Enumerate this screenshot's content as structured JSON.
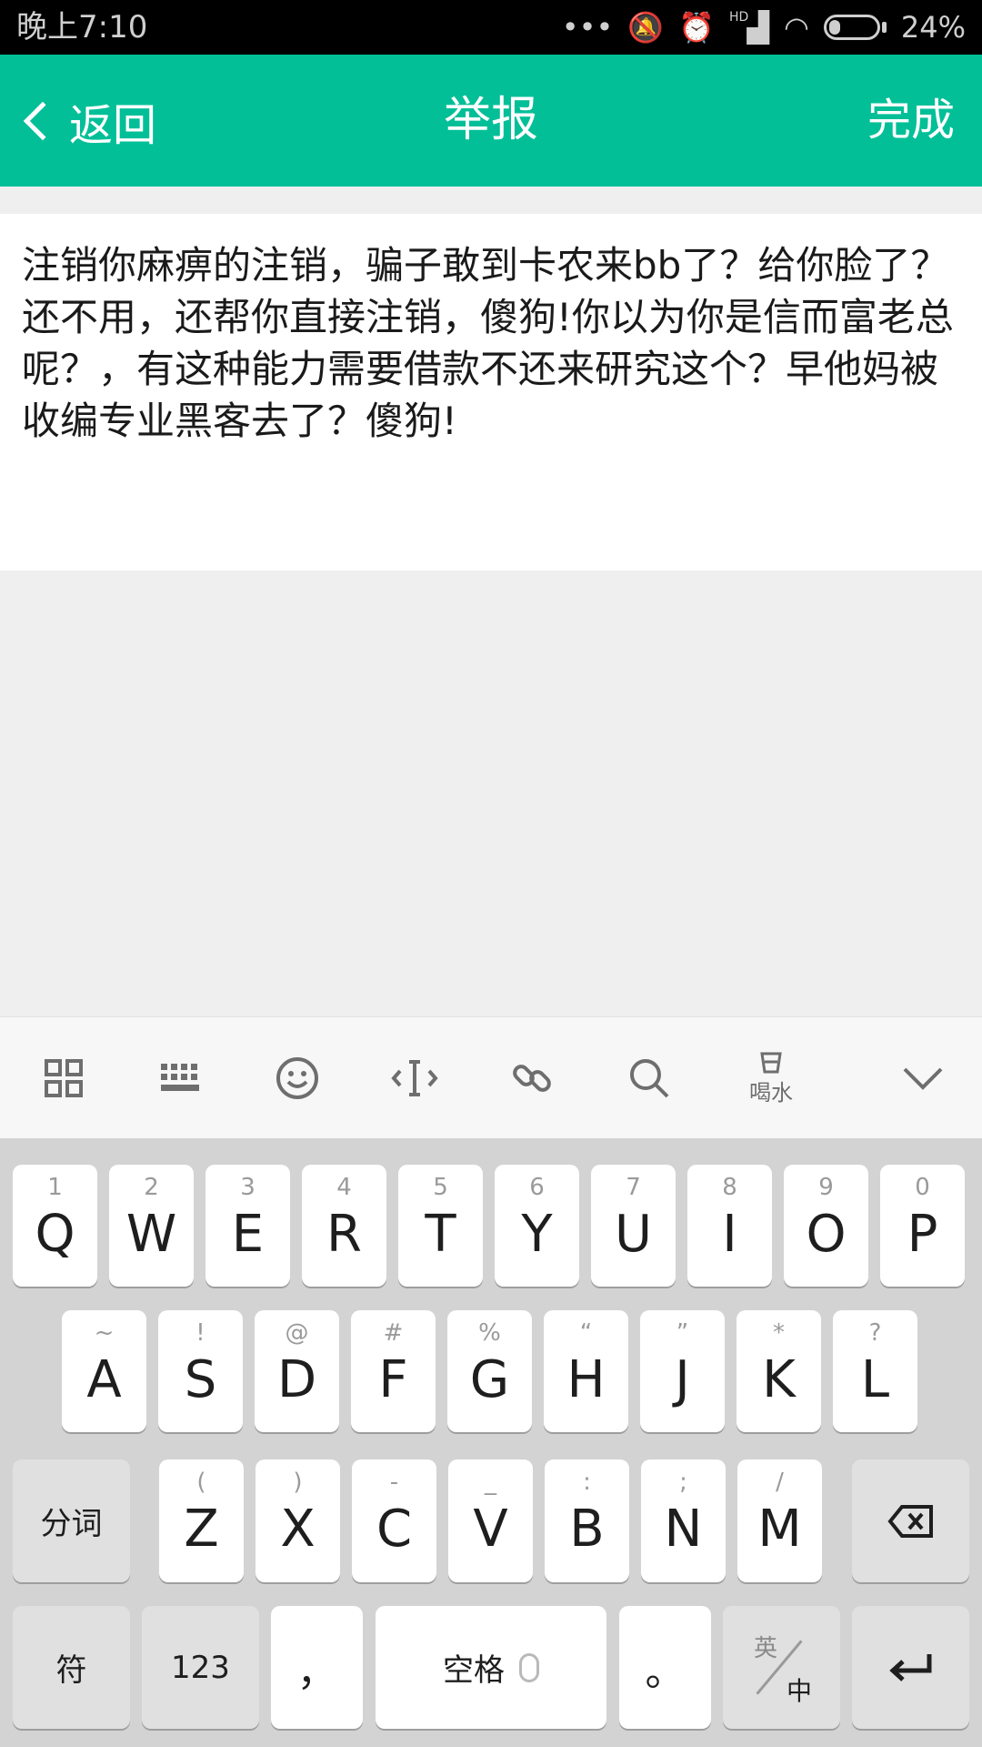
{
  "status_bar": {
    "time": "晚上7:10",
    "hd_label": "HD",
    "battery_percent": "24%",
    "battery_fraction": 0.24
  },
  "header": {
    "back_label": "返回",
    "title": "举报",
    "done_label": "完成",
    "accent_color": "#02bf98"
  },
  "report": {
    "text": "注销你麻痹的注销，骗子敢到卡农来bb了？给你脸了？还不用，还帮你直接注销，傻狗!你以为你是信而富老总呢？，有这种能力需要借款不还来研究这个？早他妈被收编专业黑客去了？傻狗!"
  },
  "ime_toolbar": {
    "icons": [
      "grid-icon",
      "keyboard-icon",
      "emoji-icon",
      "cursor-icon",
      "link-icon",
      "search-icon",
      "drink-water-icon",
      "collapse-icon"
    ],
    "drink_label": "喝水"
  },
  "keyboard": {
    "row1": [
      {
        "key": "Q",
        "hint": "1"
      },
      {
        "key": "W",
        "hint": "2"
      },
      {
        "key": "E",
        "hint": "3"
      },
      {
        "key": "R",
        "hint": "4"
      },
      {
        "key": "T",
        "hint": "5"
      },
      {
        "key": "Y",
        "hint": "6"
      },
      {
        "key": "U",
        "hint": "7"
      },
      {
        "key": "I",
        "hint": "8"
      },
      {
        "key": "O",
        "hint": "9"
      },
      {
        "key": "P",
        "hint": "0"
      }
    ],
    "row2": [
      {
        "key": "A",
        "hint": "~"
      },
      {
        "key": "S",
        "hint": "!"
      },
      {
        "key": "D",
        "hint": "@"
      },
      {
        "key": "F",
        "hint": "#"
      },
      {
        "key": "G",
        "hint": "%"
      },
      {
        "key": "H",
        "hint": "“"
      },
      {
        "key": "J",
        "hint": "”"
      },
      {
        "key": "K",
        "hint": "*"
      },
      {
        "key": "L",
        "hint": "?"
      }
    ],
    "row3": [
      {
        "key": "Z",
        "hint": "("
      },
      {
        "key": "X",
        "hint": ")"
      },
      {
        "key": "C",
        "hint": "-"
      },
      {
        "key": "V",
        "hint": "_"
      },
      {
        "key": "B",
        "hint": ":"
      },
      {
        "key": "N",
        "hint": ";"
      },
      {
        "key": "M",
        "hint": "/"
      }
    ],
    "fenci": "分词",
    "symbols": "符",
    "numbers": "123",
    "comma": "，",
    "space": "空格",
    "period": "。",
    "lang_top": "英",
    "lang_bottom": "中"
  }
}
